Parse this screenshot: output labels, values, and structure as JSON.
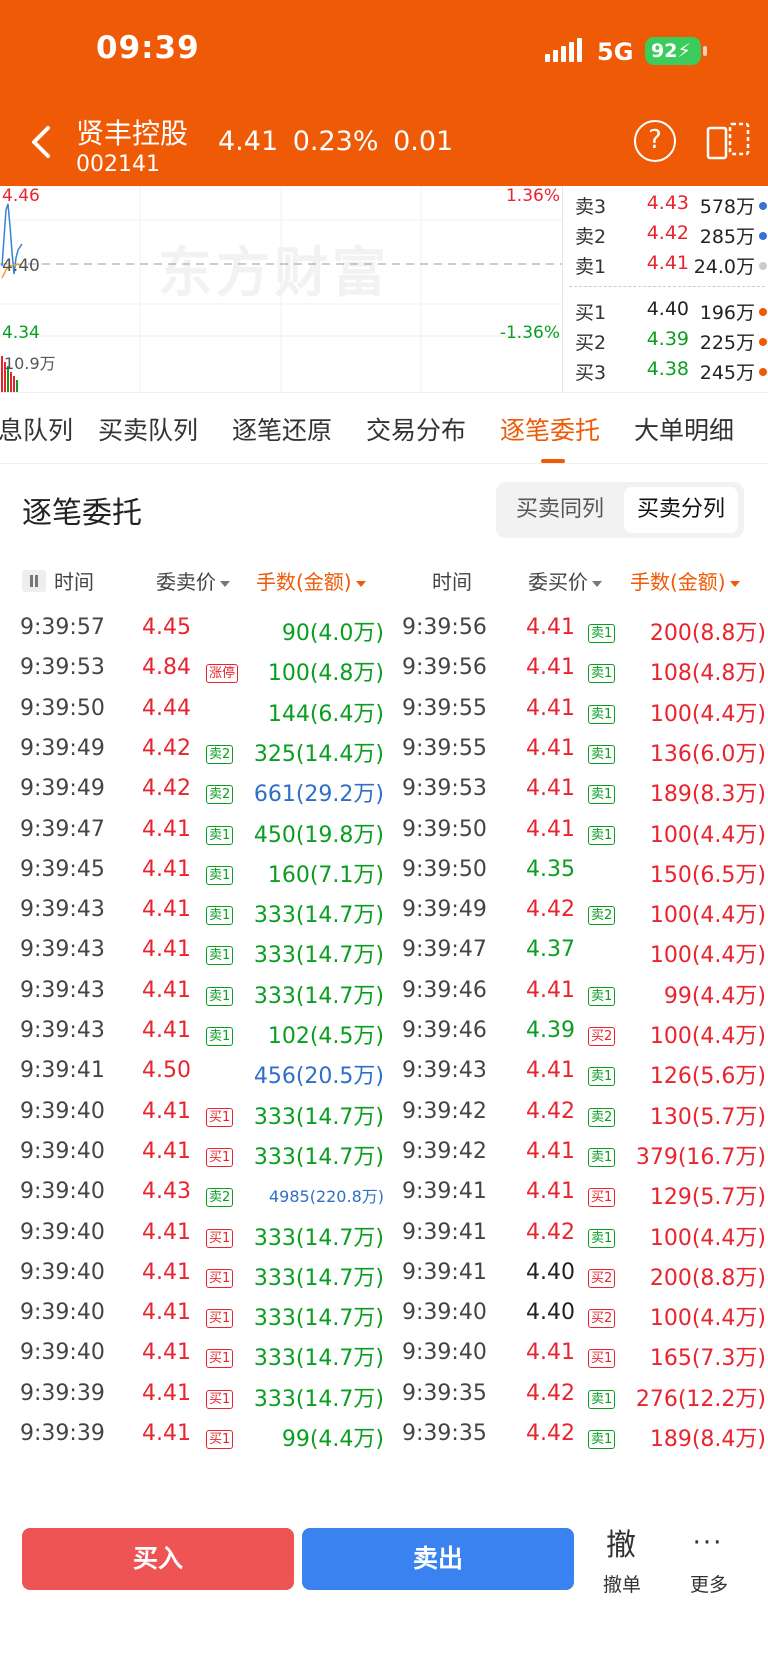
{
  "status_bar": {
    "time": "09:39",
    "network": "5G",
    "battery": "92"
  },
  "header": {
    "stock_name": "贤丰控股",
    "stock_code": "002141",
    "price": "4.41",
    "change_pct": "0.23%",
    "change": "0.01"
  },
  "chart": {
    "price_high": "4.46",
    "price_mid": "4.40",
    "price_low": "4.34",
    "pct_high": "1.36%",
    "pct_low": "-1.36%",
    "volume": "10.9万",
    "watermark": "东方财富"
  },
  "order_book": {
    "asks": [
      {
        "label": "卖3",
        "price": "4.43",
        "volume": "578万",
        "dot": "#3a6fd8"
      },
      {
        "label": "卖2",
        "price": "4.42",
        "volume": "285万",
        "dot": "#3a6fd8"
      },
      {
        "label": "卖1",
        "price": "4.41",
        "volume": "24.0万",
        "dot": "#cccccc"
      }
    ],
    "bids": [
      {
        "label": "买1",
        "price": "4.40",
        "volume": "196万",
        "dot": "#ee5a06"
      },
      {
        "label": "买2",
        "price": "4.39",
        "volume": "225万",
        "dot": "#ee5a06"
      },
      {
        "label": "买3",
        "price": "4.38",
        "volume": "245万",
        "dot": "#ee5a06"
      }
    ]
  },
  "tabs": [
    "息队列",
    "买卖队列",
    "逐笔还原",
    "交易分布",
    "逐笔委托",
    "大单明细"
  ],
  "section": {
    "title": "逐笔委托",
    "seg_left": "买卖同列",
    "seg_right": "买卖分列"
  },
  "table_header": {
    "time": "时间",
    "sell_price": "委卖价",
    "sell_qty": "手数(金额)",
    "time2": "时间",
    "buy_price": "委买价",
    "buy_qty": "手数(金额)"
  },
  "rows": [
    {
      "t1": "9:39:57",
      "p1": "4.45",
      "p1c": "red",
      "g1": "",
      "g1c": "",
      "q1": "90(4.0万)",
      "q1c": "green",
      "t2": "9:39:56",
      "p2": "4.41",
      "p2c": "red",
      "g2": "卖1",
      "g2c": "green",
      "q2": "200(8.8万)",
      "q2c": "red"
    },
    {
      "t1": "9:39:53",
      "p1": "4.84",
      "p1c": "red",
      "g1": "涨停",
      "g1c": "red",
      "q1": "100(4.8万)",
      "q1c": "green",
      "t2": "9:39:56",
      "p2": "4.41",
      "p2c": "red",
      "g2": "卖1",
      "g2c": "green",
      "q2": "108(4.8万)",
      "q2c": "red"
    },
    {
      "t1": "9:39:50",
      "p1": "4.44",
      "p1c": "red",
      "g1": "",
      "g1c": "",
      "q1": "144(6.4万)",
      "q1c": "green",
      "t2": "9:39:55",
      "p2": "4.41",
      "p2c": "red",
      "g2": "卖1",
      "g2c": "green",
      "q2": "100(4.4万)",
      "q2c": "red"
    },
    {
      "t1": "9:39:49",
      "p1": "4.42",
      "p1c": "red",
      "g1": "卖2",
      "g1c": "green",
      "q1": "325(14.4万)",
      "q1c": "green",
      "t2": "9:39:55",
      "p2": "4.41",
      "p2c": "red",
      "g2": "卖1",
      "g2c": "green",
      "q2": "136(6.0万)",
      "q2c": "red"
    },
    {
      "t1": "9:39:49",
      "p1": "4.42",
      "p1c": "red",
      "g1": "卖2",
      "g1c": "green",
      "q1": "661(29.2万)",
      "q1c": "blue",
      "t2": "9:39:53",
      "p2": "4.41",
      "p2c": "red",
      "g2": "卖1",
      "g2c": "green",
      "q2": "189(8.3万)",
      "q2c": "red"
    },
    {
      "t1": "9:39:47",
      "p1": "4.41",
      "p1c": "red",
      "g1": "卖1",
      "g1c": "green",
      "q1": "450(19.8万)",
      "q1c": "green",
      "t2": "9:39:50",
      "p2": "4.41",
      "p2c": "red",
      "g2": "卖1",
      "g2c": "green",
      "q2": "100(4.4万)",
      "q2c": "red"
    },
    {
      "t1": "9:39:45",
      "p1": "4.41",
      "p1c": "red",
      "g1": "卖1",
      "g1c": "green",
      "q1": "160(7.1万)",
      "q1c": "green",
      "t2": "9:39:50",
      "p2": "4.35",
      "p2c": "green",
      "g2": "",
      "g2c": "",
      "q2": "150(6.5万)",
      "q2c": "red"
    },
    {
      "t1": "9:39:43",
      "p1": "4.41",
      "p1c": "red",
      "g1": "卖1",
      "g1c": "green",
      "q1": "333(14.7万)",
      "q1c": "green",
      "t2": "9:39:49",
      "p2": "4.42",
      "p2c": "red",
      "g2": "卖2",
      "g2c": "green",
      "q2": "100(4.4万)",
      "q2c": "red"
    },
    {
      "t1": "9:39:43",
      "p1": "4.41",
      "p1c": "red",
      "g1": "卖1",
      "g1c": "green",
      "q1": "333(14.7万)",
      "q1c": "green",
      "t2": "9:39:47",
      "p2": "4.37",
      "p2c": "green",
      "g2": "",
      "g2c": "",
      "q2": "100(4.4万)",
      "q2c": "red"
    },
    {
      "t1": "9:39:43",
      "p1": "4.41",
      "p1c": "red",
      "g1": "卖1",
      "g1c": "green",
      "q1": "333(14.7万)",
      "q1c": "green",
      "t2": "9:39:46",
      "p2": "4.41",
      "p2c": "red",
      "g2": "卖1",
      "g2c": "green",
      "q2": "99(4.4万)",
      "q2c": "red"
    },
    {
      "t1": "9:39:43",
      "p1": "4.41",
      "p1c": "red",
      "g1": "卖1",
      "g1c": "green",
      "q1": "102(4.5万)",
      "q1c": "green",
      "t2": "9:39:46",
      "p2": "4.39",
      "p2c": "green",
      "g2": "买2",
      "g2c": "red",
      "q2": "100(4.4万)",
      "q2c": "red"
    },
    {
      "t1": "9:39:41",
      "p1": "4.50",
      "p1c": "red",
      "g1": "",
      "g1c": "",
      "q1": "456(20.5万)",
      "q1c": "blue",
      "t2": "9:39:43",
      "p2": "4.41",
      "p2c": "red",
      "g2": "卖1",
      "g2c": "green",
      "q2": "126(5.6万)",
      "q2c": "red"
    },
    {
      "t1": "9:39:40",
      "p1": "4.41",
      "p1c": "red",
      "g1": "买1",
      "g1c": "red",
      "q1": "333(14.7万)",
      "q1c": "green",
      "t2": "9:39:42",
      "p2": "4.42",
      "p2c": "red",
      "g2": "卖2",
      "g2c": "green",
      "q2": "130(5.7万)",
      "q2c": "red"
    },
    {
      "t1": "9:39:40",
      "p1": "4.41",
      "p1c": "red",
      "g1": "买1",
      "g1c": "red",
      "q1": "333(14.7万)",
      "q1c": "green",
      "t2": "9:39:42",
      "p2": "4.41",
      "p2c": "red",
      "g2": "卖1",
      "g2c": "green",
      "q2": "379(16.7万)",
      "q2c": "red"
    },
    {
      "t1": "9:39:40",
      "p1": "4.43",
      "p1c": "red",
      "g1": "卖2",
      "g1c": "green",
      "q1": "4985(220.8万)",
      "q1c": "blue small",
      "t2": "9:39:41",
      "p2": "4.41",
      "p2c": "red",
      "g2": "买1",
      "g2c": "red",
      "q2": "129(5.7万)",
      "q2c": "red"
    },
    {
      "t1": "9:39:40",
      "p1": "4.41",
      "p1c": "red",
      "g1": "买1",
      "g1c": "red",
      "q1": "333(14.7万)",
      "q1c": "green",
      "t2": "9:39:41",
      "p2": "4.42",
      "p2c": "red",
      "g2": "卖1",
      "g2c": "green",
      "q2": "100(4.4万)",
      "q2c": "red"
    },
    {
      "t1": "9:39:40",
      "p1": "4.41",
      "p1c": "red",
      "g1": "买1",
      "g1c": "red",
      "q1": "333(14.7万)",
      "q1c": "green",
      "t2": "9:39:41",
      "p2": "4.40",
      "p2c": "dark",
      "g2": "买2",
      "g2c": "red",
      "q2": "200(8.8万)",
      "q2c": "red"
    },
    {
      "t1": "9:39:40",
      "p1": "4.41",
      "p1c": "red",
      "g1": "买1",
      "g1c": "red",
      "q1": "333(14.7万)",
      "q1c": "green",
      "t2": "9:39:40",
      "p2": "4.40",
      "p2c": "dark",
      "g2": "买2",
      "g2c": "red",
      "q2": "100(4.4万)",
      "q2c": "red"
    },
    {
      "t1": "9:39:40",
      "p1": "4.41",
      "p1c": "red",
      "g1": "买1",
      "g1c": "red",
      "q1": "333(14.7万)",
      "q1c": "green",
      "t2": "9:39:40",
      "p2": "4.41",
      "p2c": "red",
      "g2": "买1",
      "g2c": "red",
      "q2": "165(7.3万)",
      "q2c": "red"
    },
    {
      "t1": "9:39:39",
      "p1": "4.41",
      "p1c": "red",
      "g1": "买1",
      "g1c": "red",
      "q1": "333(14.7万)",
      "q1c": "green",
      "t2": "9:39:35",
      "p2": "4.42",
      "p2c": "red",
      "g2": "卖1",
      "g2c": "green",
      "q2": "276(12.2万)",
      "q2c": "red"
    },
    {
      "t1": "9:39:39",
      "p1": "4.41",
      "p1c": "red",
      "g1": "买1",
      "g1c": "red",
      "q1": "99(4.4万)",
      "q1c": "green",
      "t2": "9:39:35",
      "p2": "4.42",
      "p2c": "red",
      "g2": "卖1",
      "g2c": "green",
      "q2": "189(8.4万)",
      "q2c": "red"
    }
  ],
  "bottom_bar": {
    "buy": "买入",
    "sell": "卖出",
    "cancel_icon": "撤",
    "cancel": "撤单",
    "more": "更多"
  }
}
